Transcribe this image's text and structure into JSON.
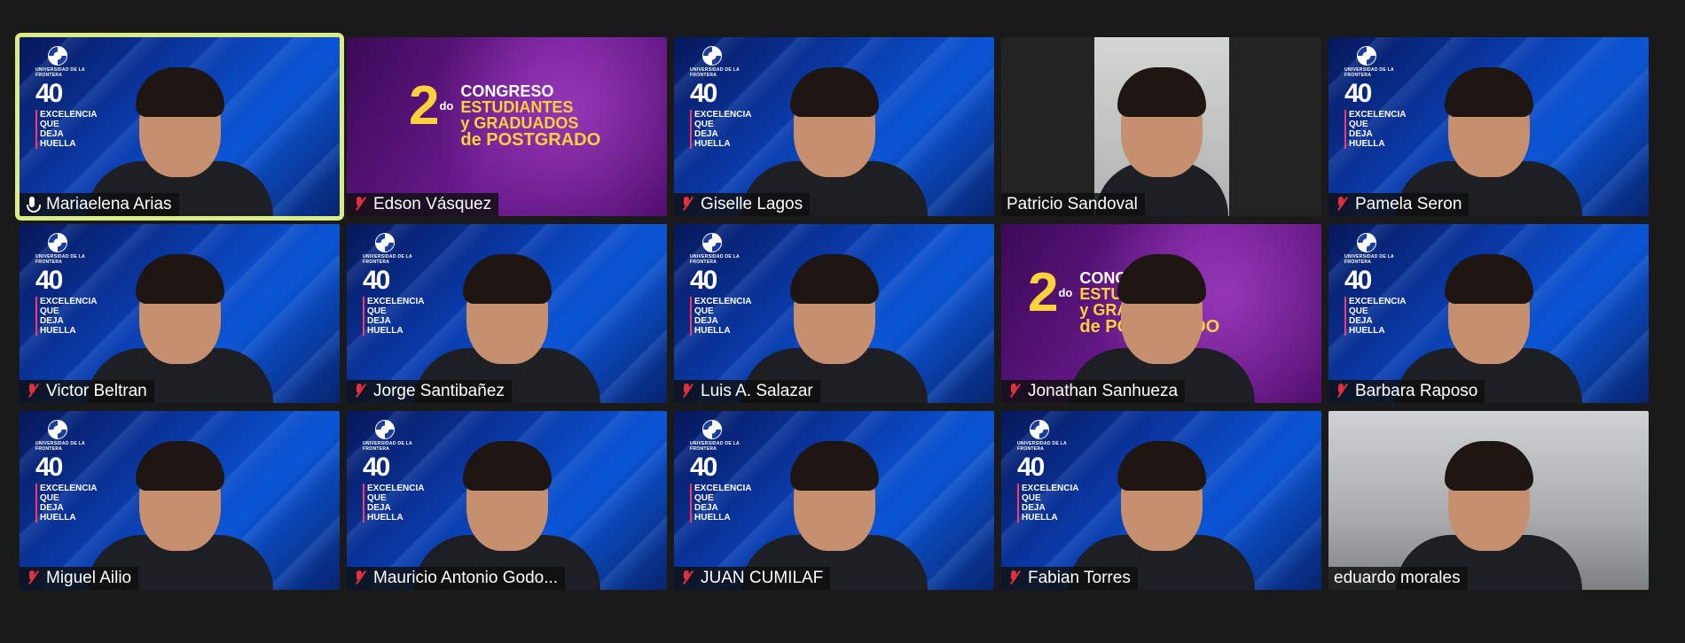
{
  "meeting": {
    "participants": [
      {
        "name": "Mariaelena Arias",
        "mic": "speaking",
        "background": "blue",
        "active": true
      },
      {
        "name": "Edson Vásquez",
        "mic": "muted",
        "background": "purple-banner",
        "active": false
      },
      {
        "name": "Giselle Lagos",
        "mic": "muted",
        "background": "blue",
        "active": false
      },
      {
        "name": "Patricio Sandoval",
        "mic": "none",
        "background": "dark-frame",
        "active": false
      },
      {
        "name": "Pamela Seron",
        "mic": "muted",
        "background": "blue",
        "active": false
      },
      {
        "name": "Victor Beltran",
        "mic": "muted",
        "background": "blue",
        "active": false
      },
      {
        "name": "Jorge Santibañez",
        "mic": "muted",
        "background": "blue",
        "active": false
      },
      {
        "name": "Luis A. Salazar",
        "mic": "muted",
        "background": "blue",
        "active": false
      },
      {
        "name": "Jonathan Sanhueza",
        "mic": "muted",
        "background": "purple-banner",
        "active": false
      },
      {
        "name": "Barbara Raposo",
        "mic": "muted",
        "background": "blue",
        "active": false
      },
      {
        "name": "Miguel Ailio",
        "mic": "muted",
        "background": "blue",
        "active": false
      },
      {
        "name": "Mauricio Antonio Godo...",
        "mic": "muted",
        "background": "blue",
        "active": false
      },
      {
        "name": "JUAN CUMILAF",
        "mic": "muted",
        "background": "blue",
        "active": false
      },
      {
        "name": "Fabian Torres",
        "mic": "muted",
        "background": "blue",
        "active": false
      },
      {
        "name": "eduardo morales",
        "mic": "none",
        "background": "office",
        "active": false
      }
    ]
  },
  "logo": {
    "university": "UNIVERSIDAD DE LA FRONTERA",
    "anniversary": "40",
    "motto_line1": "EXCELENCIA",
    "motto_line2": "QUE DEJA",
    "motto_line3": "HUELLA"
  },
  "banner": {
    "number": "2",
    "ordinal": "do",
    "line1": "CONGRESO",
    "line2": "ESTUDIANTES",
    "line3": "y GRADUADOS",
    "line4": "de POSTGRADO"
  },
  "colors": {
    "active_border": "#d9ec88",
    "muted_mic": "#e0303f",
    "accent_yellow": "#ffd23a"
  }
}
